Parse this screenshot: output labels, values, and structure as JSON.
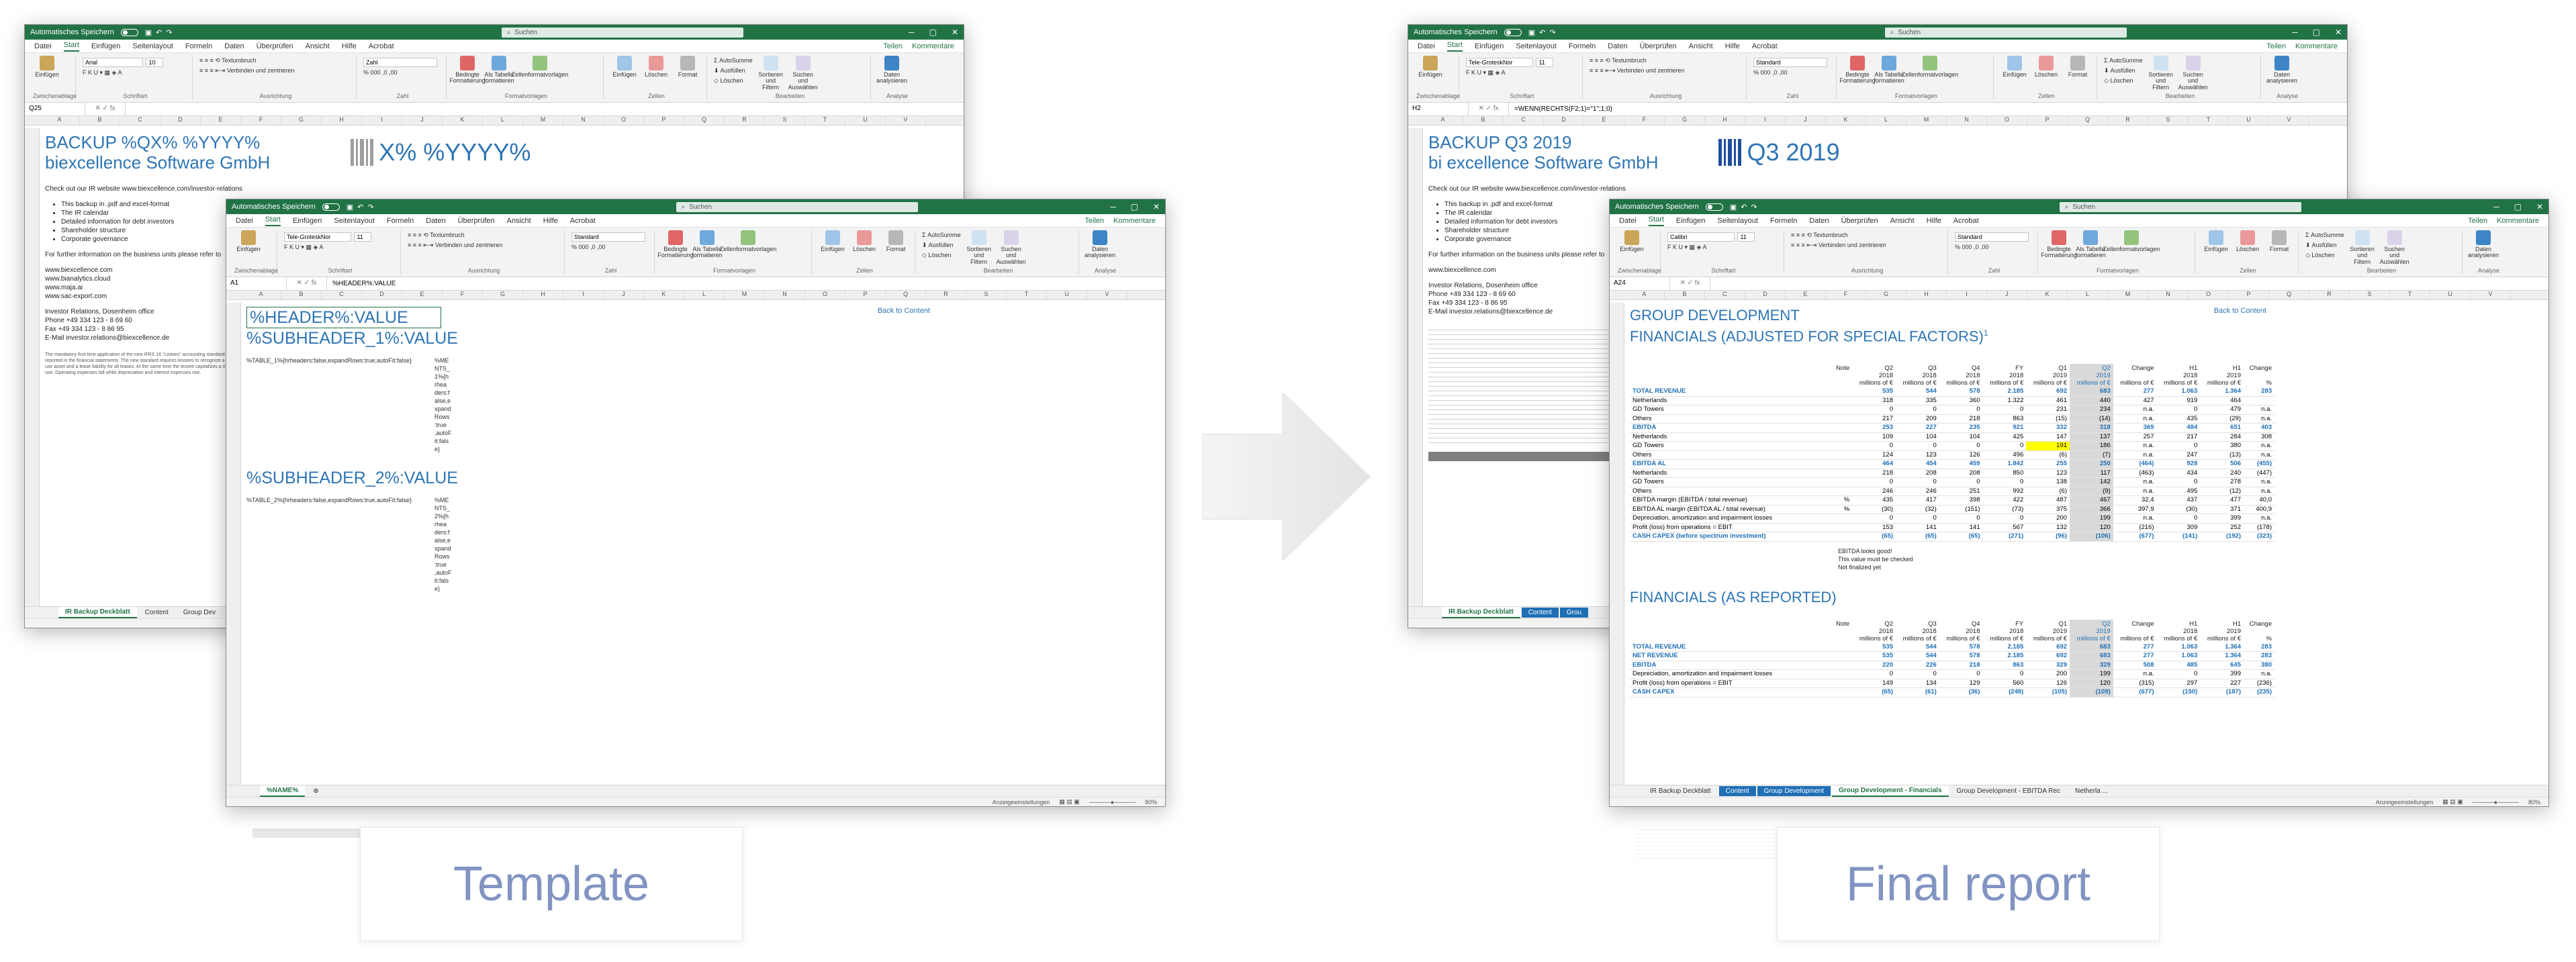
{
  "excel": {
    "autosave_label": "Automatisches Speichern",
    "search_placeholder": "Suchen",
    "menu": [
      "Datei",
      "Start",
      "Einfügen",
      "Seitenlayout",
      "Formeln",
      "Daten",
      "Überprüfen",
      "Ansicht",
      "Hilfe",
      "Acrobat"
    ],
    "share": "Teilen",
    "comments": "Kommentare",
    "ribbon": {
      "paste": "Einfügen",
      "clipboard": "Zwischenablage",
      "font_group": "Schriftart",
      "alignment": "Ausrichtung",
      "number": "Zahl",
      "formats": "Formatvorlagen",
      "cells": "Zellen",
      "editing": "Bearbeiten",
      "analysis": "Analyse",
      "wrap": "Textumbruch",
      "merge": "Verbinden und zentrieren",
      "cond_format": "Bedingte Formatierung",
      "as_table": "Als Tabelle formatieren",
      "cell_styles": "Zellenformatvorlagen",
      "insert": "Einfügen",
      "delete": "Löschen",
      "format": "Format",
      "autosum": "AutoSumme",
      "fill": "Ausfüllen",
      "clear": "Löschen",
      "sort": "Sortieren und Filtern",
      "find": "Suchen und Auswählen",
      "analyze": "Daten analysieren",
      "number_fmt": "Standard"
    },
    "status_settings": "Anzeigeeinstellungen",
    "zoom": "80%"
  },
  "template_back": {
    "font": "Arial",
    "size": "10",
    "numfmt": "Zahl",
    "namebox": "Q25",
    "title1": "BACKUP %QX% %YYYY%",
    "title2": "biexcellence Software GmbH",
    "logo_text": "X% %YYYY%",
    "intro": "Check out our IR website www.biexcellence.com/investor-relations",
    "bullets": [
      "This backup in .pdf and excel-format",
      "The IR calendar",
      "Detailed information for debt investors",
      "Shareholder structure",
      "Corporate governance"
    ],
    "further": "For further information on the business units please refer to",
    "links": [
      "www.biexcellence.com",
      "www.bianalytics.cloud",
      "www.maja.ai",
      "www.sac-export.com"
    ],
    "ir_office": "Investor Relations, Dosenheim office",
    "phone": "Phone     +49 334 123 - 8 69 60",
    "fax": "Fax         +49 334 123 - 8 86 95",
    "email": "E-Mail     investor.relations@biexcellence.de",
    "body": "The mandatory first-time application of the new IFRS 16 \"Leases\" accounting standard is reported in the financial statements. The new standard requires lessees to recognize a right-of-use asset and a lease liability for all leases. At the same time the lessee capitalizes a right of use. Operating expenses fall while depreciation and interest expenses rise.",
    "tabs": [
      "IR Backup Deckblatt",
      "Content",
      "Group Dev"
    ]
  },
  "template_front": {
    "font": "Tele-GroteskNor",
    "size": "11",
    "namebox": "A1",
    "formula": "%HEADER%:VALUE",
    "header": "%HEADER%:VALUE",
    "sub1": "%SUBHEADER_1%:VALUE",
    "table1": "%TABLE_1%{hrheaders:false,expandRows:true,autoFit:false}",
    "sub2": "%SUBHEADER_2%:VALUE",
    "table2": "%TABLE_2%{hrheaders:false,expandRows:true,autoFit:false}",
    "vertical1": "%ME\nNTS_\n1%{h\nrhea\nders:f\nalse,e\nxpand\nRows\n:true\n,autoF\nit:fals\ne}",
    "vertical2": "%ME\nNTS_\n2%{h\nrhea\nders:f\nalse,e\nxpand\nRows\n:true\n,autoF\nit:fals\ne}",
    "back": "Back to Content",
    "tab": "%NAME%"
  },
  "final_back": {
    "font": "Tele-GroteskNor",
    "size": "11",
    "namebox": "H2",
    "formula": "=WENN(RECHTS(F2;1)=\"1\";1;0)",
    "title1": "BACKUP Q3 2019",
    "title2": "bi excellence Software GmbH",
    "logo_text": "Q3 2019",
    "intro": "Check out our IR website www.biexcellence.com/investor-relations",
    "bullets": [
      "This backup in .pdf and excel-format",
      "The IR calendar",
      "Detailed information for debt investors",
      "Shareholder structure",
      "Corporate governance"
    ],
    "further": "For further information on the business units please refer to",
    "links": [
      "www.biexcellence.com"
    ],
    "ir_office": "Investor Relations, Dosenheim office",
    "phone": "Phone     +49 334 123 - 8 69 60",
    "fax": "Fax         +49 334 123 - 8 86 95",
    "email": "E-Mail     investor.relations@biexcellence.de",
    "tabs": [
      "IR Backup Deckblatt",
      "Content",
      "Grou"
    ]
  },
  "final_front": {
    "font": "Calibri",
    "size": "11",
    "namebox": "A24",
    "title1": "GROUP DEVELOPMENT",
    "title2": "FINANCIALS (ADJUSTED FOR SPECIAL FACTORS)",
    "title2_sup": "1",
    "title3": "FINANCIALS (AS REPORTED)",
    "back": "Back to Content",
    "headers": [
      {
        "top": "Note",
        "mid": "",
        "bot": ""
      },
      {
        "top": "Q2",
        "mid": "2018",
        "bot": "millions of €"
      },
      {
        "top": "Q3",
        "mid": "2018",
        "bot": "millions of €"
      },
      {
        "top": "Q4",
        "mid": "2018",
        "bot": "millions of €"
      },
      {
        "top": "FY",
        "mid": "2018",
        "bot": "millions of €"
      },
      {
        "top": "Q1",
        "mid": "2019",
        "bot": "millions of €"
      },
      {
        "top": "Q2",
        "mid": "2019",
        "bot": "millions of €"
      },
      {
        "top": "Change",
        "mid": "",
        "bot": "millions of €"
      },
      {
        "top": "H1",
        "mid": "2018",
        "bot": "millions of €"
      },
      {
        "top": "H1",
        "mid": "2019",
        "bot": "millions of €"
      },
      {
        "top": "Change",
        "mid": "",
        "bot": "%"
      }
    ],
    "rows1": [
      {
        "l": "TOTAL REVENUE",
        "n": "",
        "v": [
          "535",
          "544",
          "578",
          "2.185",
          "692",
          "683",
          "277",
          "1.063",
          "1.364",
          "283"
        ],
        "b": true
      },
      {
        "l": "Netherlands",
        "n": "",
        "v": [
          "318",
          "335",
          "360",
          "1.322",
          "461",
          "440",
          "427",
          "919",
          "464",
          ""
        ]
      },
      {
        "l": "GD Towers",
        "n": "",
        "v": [
          "0",
          "0",
          "0",
          "0",
          "231",
          "234",
          "n.a.",
          "0",
          "479",
          "n.a."
        ]
      },
      {
        "l": "Others",
        "n": "",
        "v": [
          "217",
          "209",
          "218",
          "863",
          "(15)",
          "(14)",
          "n.a.",
          "435",
          "(29)",
          "n.a."
        ]
      },
      {
        "l": "EBITDA",
        "n": "",
        "v": [
          "253",
          "227",
          "235",
          "921",
          "332",
          "318",
          "369",
          "484",
          "651",
          "403"
        ],
        "b": true
      },
      {
        "l": "Netherlands",
        "n": "",
        "v": [
          "109",
          "104",
          "104",
          "425",
          "147",
          "137",
          "257",
          "217",
          "284",
          "308"
        ]
      },
      {
        "l": "GD Towers",
        "n": "",
        "v": [
          "0",
          "0",
          "0",
          "0",
          "191",
          "186",
          "n.a.",
          "0",
          "380",
          "n.a."
        ],
        "y": true
      },
      {
        "l": "Others",
        "n": "",
        "v": [
          "124",
          "123",
          "126",
          "496",
          "(6)",
          "(7)",
          "n.a.",
          "247",
          "(13)",
          "n.a."
        ]
      },
      {
        "l": "EBITDA AL",
        "n": "",
        "v": [
          "464",
          "454",
          "459",
          "1.842",
          "255",
          "250",
          "(464)",
          "928",
          "506",
          "(455)"
        ],
        "b": true
      },
      {
        "l": "Netherlands",
        "n": "",
        "v": [
          "218",
          "208",
          "208",
          "850",
          "123",
          "117",
          "(463)",
          "434",
          "240",
          "(447)"
        ]
      },
      {
        "l": "GD Towers",
        "n": "",
        "v": [
          "0",
          "0",
          "0",
          "0",
          "138",
          "142",
          "n.a.",
          "0",
          "278",
          "n.a."
        ]
      },
      {
        "l": "Others",
        "n": "",
        "v": [
          "246",
          "246",
          "251",
          "992",
          "(6)",
          "(9)",
          "n.a.",
          "495",
          "(12)",
          "n.a."
        ]
      },
      {
        "l": "EBITDA margin (EBITDA / total revenue)",
        "n": "%",
        "v": [
          "435",
          "417",
          "398",
          "422",
          "487",
          "467",
          "32,4",
          "437",
          "477",
          "40,0"
        ]
      },
      {
        "l": "EBITDA AL margin (EBITDA AL / total revenue)",
        "n": "%",
        "v": [
          "(30)",
          "(32)",
          "(151)",
          "(73)",
          "375",
          "366",
          "397,9",
          "(30)",
          "371",
          "400,9"
        ]
      },
      {
        "l": "Depreciation, amortization and impairment losses",
        "n": "",
        "v": [
          "0",
          "0",
          "0",
          "0",
          "200",
          "199",
          "n.a.",
          "0",
          "399",
          "n.a."
        ]
      },
      {
        "l": "Profit (loss) from operations = EBIT",
        "n": "",
        "v": [
          "153",
          "141",
          "141",
          "567",
          "132",
          "120",
          "(216)",
          "309",
          "252",
          "(178)"
        ]
      },
      {
        "l": "CASH CAPEX (before spectrum investment)",
        "n": "",
        "v": [
          "(65)",
          "(65)",
          "(65)",
          "(271)",
          "(96)",
          "(106)",
          "(677)",
          "(141)",
          "(192)",
          "(323)"
        ],
        "b": true
      }
    ],
    "notes": [
      "EBITDA looks good!",
      "This value must be checked",
      "Not finalized yet"
    ],
    "rows2": [
      {
        "l": "TOTAL REVENUE",
        "n": "",
        "v": [
          "535",
          "544",
          "578",
          "2.185",
          "692",
          "683",
          "277",
          "1.063",
          "1.364",
          "283"
        ],
        "b": true
      },
      {
        "l": "NET REVENUE",
        "n": "",
        "v": [
          "535",
          "544",
          "578",
          "2.185",
          "692",
          "683",
          "277",
          "1.063",
          "1.364",
          "283"
        ],
        "b": true
      },
      {
        "l": "EBITDA",
        "n": "",
        "v": [
          "220",
          "226",
          "218",
          "863",
          "329",
          "329",
          "508",
          "485",
          "645",
          "380"
        ],
        "b": true
      },
      {
        "l": "Depreciation, amortization and impairment losses",
        "n": "",
        "v": [
          "0",
          "0",
          "0",
          "0",
          "200",
          "199",
          "n.a.",
          "0",
          "399",
          "n.a."
        ]
      },
      {
        "l": "Profit (loss) from operations = EBIT",
        "n": "",
        "v": [
          "149",
          "134",
          "129",
          "560",
          "126",
          "120",
          "(315)",
          "297",
          "227",
          "(236)"
        ]
      },
      {
        "l": "CASH CAPEX",
        "n": "",
        "v": [
          "(65)",
          "(61)",
          "(36)",
          "(248)",
          "(105)",
          "(109)",
          "(677)",
          "(150)",
          "(187)",
          "(235)"
        ],
        "b": true
      }
    ],
    "tabs": [
      "IR Backup Deckblatt",
      "Content",
      "Group Development",
      "Group Development - Financials",
      "Group Development - EBITDA Rec",
      "Netherla ..."
    ]
  },
  "captions": {
    "left": "Template",
    "right": "Final report"
  },
  "colors": {
    "excel_green": "#217346",
    "title_blue": "#2e75b6",
    "caption": "#8194c2"
  }
}
